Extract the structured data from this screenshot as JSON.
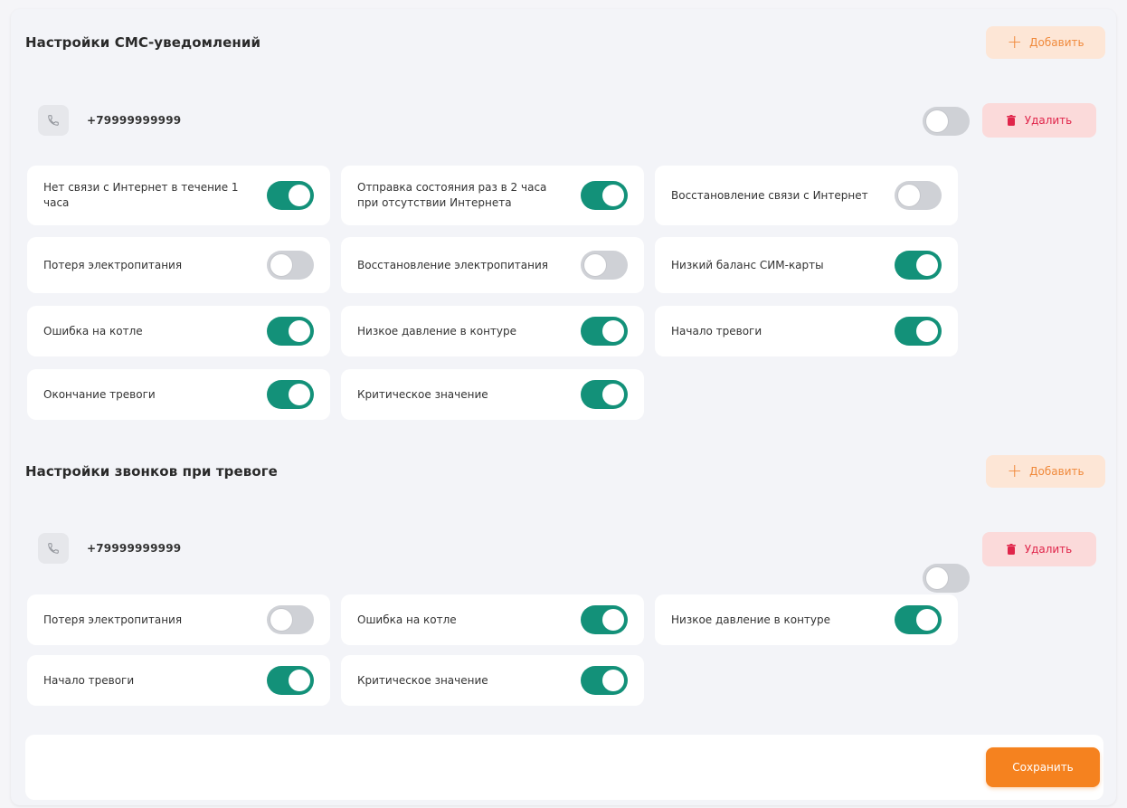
{
  "sms": {
    "title": "Настройки СМС-уведомлений",
    "add_label": "Добавить",
    "phone": "+79999999999",
    "phone_enabled": false,
    "delete_label": "Удалить",
    "options": [
      {
        "label": "Нет связи с Интернет в течение 1 часа",
        "on": true
      },
      {
        "label": "Отправка состояния раз в 2 часа при отсутствии Интернета",
        "on": true
      },
      {
        "label": "Восстановление связи с Интернет",
        "on": false
      },
      {
        "label": "Потеря электропитания",
        "on": false
      },
      {
        "label": "Восстановление электропитания",
        "on": false
      },
      {
        "label": "Низкий баланс СИМ-карты",
        "on": true
      },
      {
        "label": "Ошибка на котле",
        "on": true
      },
      {
        "label": "Низкое давление в контуре",
        "on": true
      },
      {
        "label": "Начало тревоги",
        "on": true
      },
      {
        "label": "Окончание тревоги",
        "on": true
      },
      {
        "label": "Критическое значение",
        "on": true
      }
    ]
  },
  "calls": {
    "title": "Настройки звонков при тревоге",
    "add_label": "Добавить",
    "phone": "+79999999999",
    "phone_enabled": false,
    "delete_label": "Удалить",
    "options": [
      {
        "label": "Потеря электропитания",
        "on": false
      },
      {
        "label": "Ошибка на котле",
        "on": true
      },
      {
        "label": "Низкое давление в контуре",
        "on": true
      },
      {
        "label": "Начало тревоги",
        "on": true
      },
      {
        "label": "Критическое значение",
        "on": true
      }
    ]
  },
  "footer": {
    "save_label": "Сохранить"
  },
  "colors": {
    "accent": "#f5821f",
    "toggle_on": "#139179",
    "toggle_off": "#cfd1d6",
    "danger": "#e0254a"
  },
  "icons": {
    "add": "plus-icon",
    "phone": "phone-icon",
    "delete": "trash-icon"
  }
}
